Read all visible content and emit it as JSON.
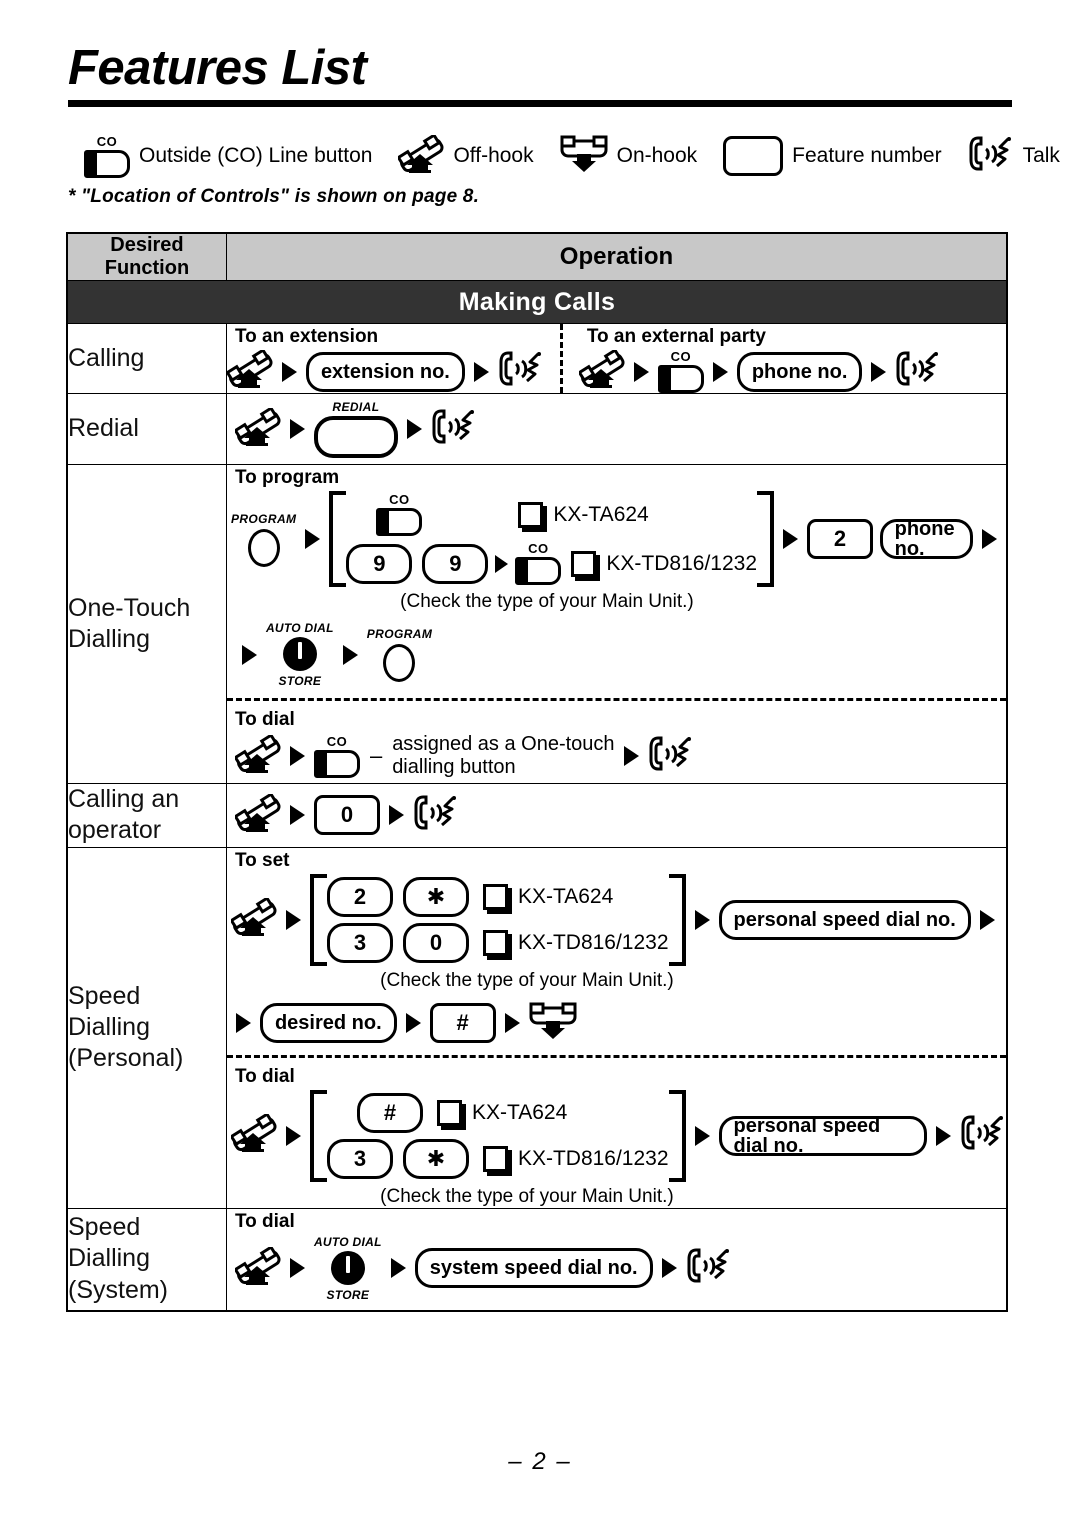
{
  "page": {
    "title": "Features List",
    "note": "* \"Location of Controls\" is shown on page 8.",
    "page_number": "– 2 –"
  },
  "legend": [
    {
      "icon": "co-line-button-icon",
      "label": "Outside (CO) Line button",
      "cap": "CO"
    },
    {
      "icon": "off-hook-icon",
      "label": "Off-hook"
    },
    {
      "icon": "on-hook-icon",
      "label": "On-hook"
    },
    {
      "icon": "feature-number-key-icon",
      "label": "Feature number"
    },
    {
      "icon": "talk-icon",
      "label": "Talk"
    }
  ],
  "table": {
    "headers": {
      "function": "Desired Function",
      "operation": "Operation"
    },
    "section": "Making Calls",
    "common": {
      "check_unit": "(Check the type of your Main Unit.)",
      "model_a": "KX-TA624",
      "model_b": "KX-TD816/1232",
      "to_program": "To program",
      "to_dial": "To dial",
      "to_set": "To set"
    },
    "rows": {
      "calling": {
        "function": "Calling",
        "left_title": "To an extension",
        "right_title": "To an external party",
        "extension_no": "extension no.",
        "phone_no": "phone no."
      },
      "redial": {
        "function": "Redial",
        "key_cap": "REDIAL"
      },
      "one_touch": {
        "function_line1": "One-Touch",
        "function_line2": "Dialling",
        "program_cap": "PROGRAM",
        "digit_9a": "9",
        "digit_9b": "9",
        "key_2": "2",
        "phone_no": "phone no.",
        "autodial_cap_top": "AUTO DIAL",
        "autodial_cap_bottom": "STORE",
        "dash": "–",
        "assigned_line1": "assigned as a One-touch",
        "assigned_line2": "dialling button"
      },
      "operator": {
        "function_line1": "Calling an",
        "function_line2": "operator",
        "key_0": "0"
      },
      "speed_personal": {
        "function_line1": "Speed Dialling",
        "function_line2": "(Personal)",
        "set_key_2": "2",
        "set_key_star": "✱",
        "set_key_3": "3",
        "set_key_0": "0",
        "personal_speed_dial_no": "personal speed dial no.",
        "desired_no": "desired no.",
        "key_hash": "#",
        "dial_key_hash": "#",
        "dial_key_3": "3",
        "dial_key_star": "✱"
      },
      "speed_system": {
        "function_line1": "Speed Dialling",
        "function_line2": "(System)",
        "autodial_cap_top": "AUTO DIAL",
        "autodial_cap_bottom": "STORE",
        "system_speed_dial_no": "system speed dial no."
      }
    }
  },
  "colors": {
    "header_bg": "#c8c8c8",
    "section_bg": "#333333",
    "section_fg": "#ffffff",
    "ink": "#000000"
  }
}
